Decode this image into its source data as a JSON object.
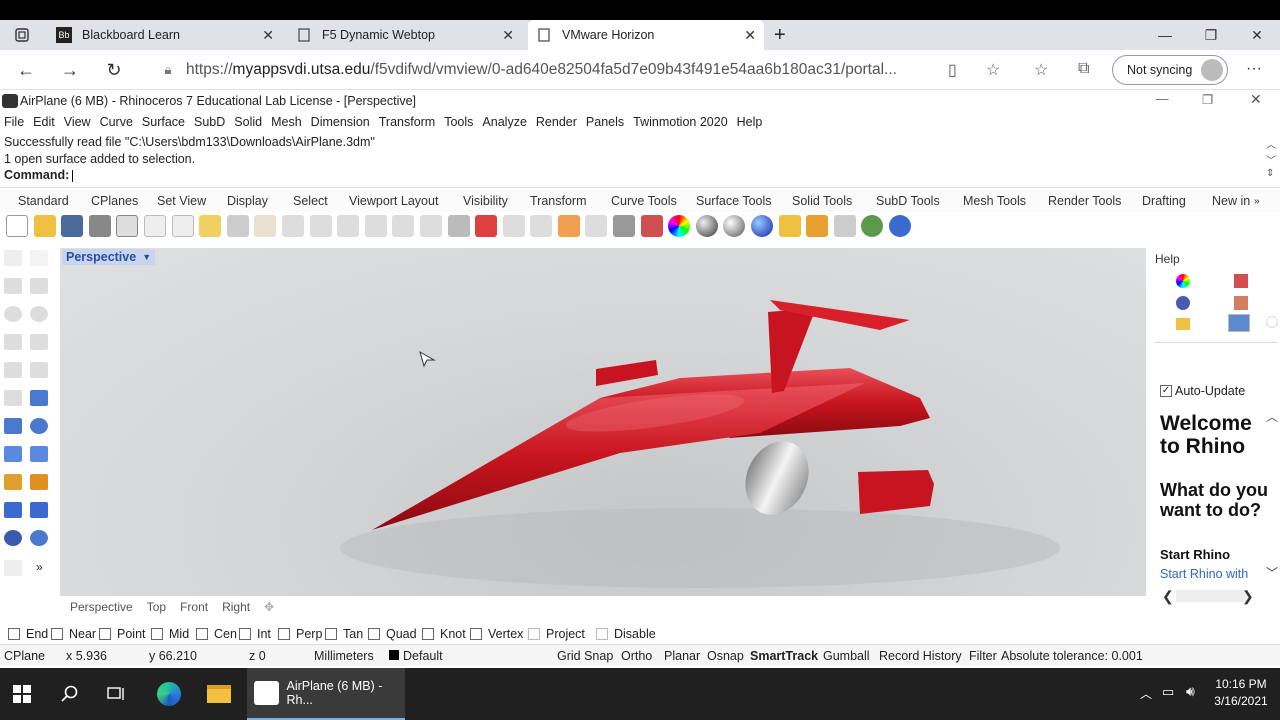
{
  "browser": {
    "tabs": [
      {
        "title": "Blackboard Learn",
        "icon": "blackboard-icon"
      },
      {
        "title": "F5 Dynamic Webtop",
        "icon": "page-icon"
      },
      {
        "title": "VMware Horizon",
        "icon": "page-icon"
      }
    ],
    "new_tab": "+",
    "url_prefix": "https://",
    "url_host": "myappsvdi.utsa.edu",
    "url_path": "/f5vdifwd/vmview/0-ad640e82504fa5d7e09b43f491e54aa6b180ac31/portal...",
    "not_syncing": "Not syncing",
    "menu": "···"
  },
  "rhino": {
    "title": "AirPlane (6 MB) - Rhinoceros 7 Educational Lab License - [Perspective]",
    "menu": [
      "File",
      "Edit",
      "View",
      "Curve",
      "Surface",
      "SubD",
      "Solid",
      "Mesh",
      "Dimension",
      "Transform",
      "Tools",
      "Analyze",
      "Render",
      "Panels",
      "Twinmotion 2020",
      "Help"
    ],
    "history": [
      "Successfully read file \"C:\\Users\\bdm133\\Downloads\\AirPlane.3dm\"",
      "1 open surface added to selection."
    ],
    "command_label": "Command:",
    "tool_tabs": [
      "Standard",
      "CPlanes",
      "Set View",
      "Display",
      "Select",
      "Viewport Layout",
      "Visibility",
      "Transform",
      "Curve Tools",
      "Surface Tools",
      "Solid Tools",
      "SubD Tools",
      "Mesh Tools",
      "Render Tools",
      "Drafting",
      "New in"
    ],
    "viewport_label": "Perspective",
    "viewport_tabs": [
      "Perspective",
      "Top",
      "Front",
      "Right"
    ],
    "panel": {
      "title": "Help",
      "auto_update": "Auto-Update",
      "welcome": "Welcome to Rhino",
      "question": "What do you want to do?",
      "start": "Start Rhino",
      "link": "Start Rhino with shortcuts"
    },
    "osnaps": [
      {
        "label": "End",
        "checked": false
      },
      {
        "label": "Near",
        "checked": false
      },
      {
        "label": "Point",
        "checked": false
      },
      {
        "label": "Mid",
        "checked": false
      },
      {
        "label": "Cen",
        "checked": false
      },
      {
        "label": "Int",
        "checked": false
      },
      {
        "label": "Perp",
        "checked": false
      },
      {
        "label": "Tan",
        "checked": false
      },
      {
        "label": "Quad",
        "checked": false
      },
      {
        "label": "Knot",
        "checked": false
      },
      {
        "label": "Vertex",
        "checked": false
      },
      {
        "label": "Project",
        "checked": false
      },
      {
        "label": "Disable",
        "checked": false
      }
    ],
    "status": {
      "cplane": "CPlane",
      "x": "x 5.936",
      "y": "y 66.210",
      "z": "z 0",
      "units": "Millimeters",
      "layer": "Default",
      "grid_snap": "Grid Snap",
      "ortho": "Ortho",
      "planar": "Planar",
      "osnap": "Osnap",
      "smarttrack": "SmartTrack",
      "gumball": "Gumball",
      "record_history": "Record History",
      "filter": "Filter",
      "tolerance": "Absolute tolerance: 0.001"
    }
  },
  "taskbar": {
    "app_label": "AirPlane (6 MB) - Rh...",
    "time": "10:16 PM",
    "date": "3/16/2021"
  }
}
